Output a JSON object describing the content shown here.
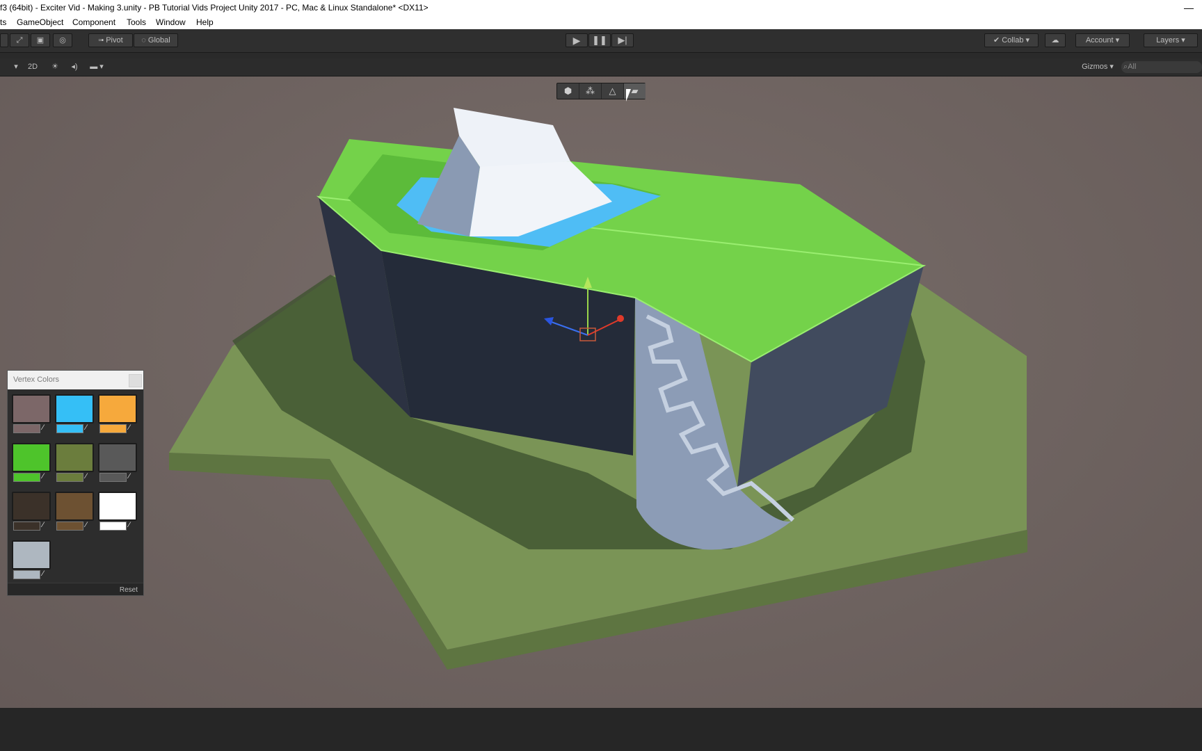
{
  "window": {
    "title": "f3 (64bit) - Exciter Vid - Making 3.unity - PB Tutorial Vids Project Unity 2017 - PC, Mac & Linux Standalone* <DX11>",
    "minimize_icon": "minimize-icon"
  },
  "menu": {
    "items": [
      "ts",
      "GameObject",
      "Component",
      "Tools",
      "Window",
      "Help"
    ]
  },
  "toolbar": {
    "pivot_label": "Pivot",
    "global_label": "Global",
    "collab_label": "Collab",
    "account_label": "Account",
    "layers_label": "Layers",
    "icons": [
      "scale-tool-icon",
      "rect-tool-icon",
      "transform-tool-icon",
      "play-icon",
      "pause-icon",
      "step-icon",
      "cloud-icon"
    ]
  },
  "scene_bar": {
    "mode_2d": "2D",
    "gizmos_label": "Gizmos",
    "search_placeholder": "All"
  },
  "probuilder_tools": [
    "object-mode-icon",
    "vertex-mode-icon",
    "edge-mode-icon",
    "face-mode-icon"
  ],
  "vertex_colors": {
    "title": "Vertex Colors",
    "reset_label": "Reset",
    "swatches": [
      "#7c6768",
      "#35bff6",
      "#f6a93c",
      "#4ec42b",
      "#6b7d3d",
      "#595959",
      "#3b3129",
      "#6d5132",
      "#ffffff",
      "#aeb7c0"
    ]
  },
  "colors": {
    "grass": "#78d94e",
    "water": "#4fbdf5",
    "base": "#779254",
    "wall": "#2f3645"
  }
}
